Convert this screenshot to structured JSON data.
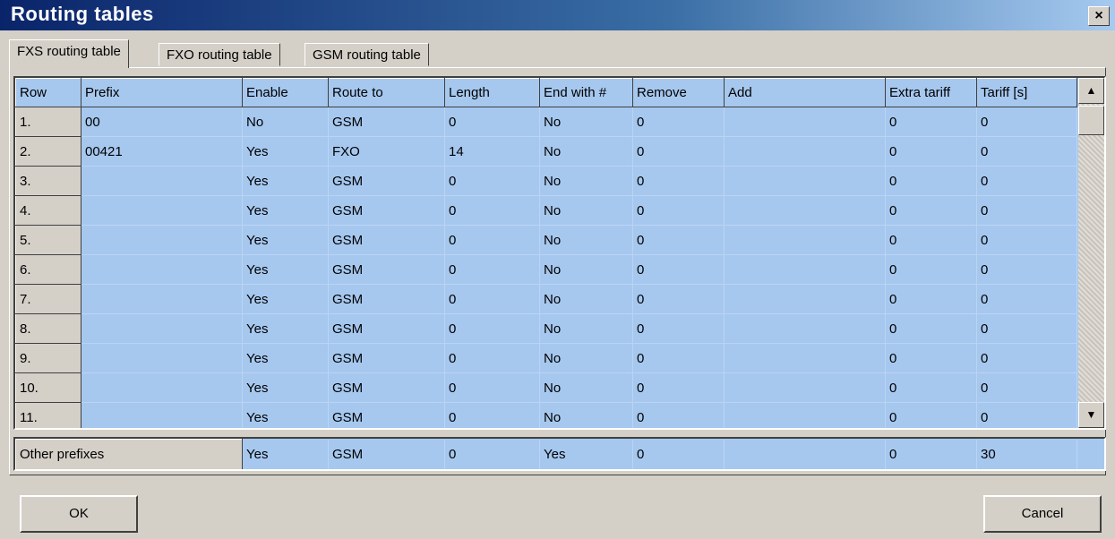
{
  "window": {
    "title": "Routing tables",
    "close_label": "×"
  },
  "tabs": [
    {
      "label": "FXS routing table",
      "active": true
    },
    {
      "label": "FXO routing table",
      "active": false
    },
    {
      "label": "GSM routing table",
      "active": false
    }
  ],
  "columns": [
    "Row",
    "Prefix",
    "Enable",
    "Route to",
    "Length",
    "End with #",
    "Remove",
    "Add",
    "Extra tariff",
    "Tariff [s]"
  ],
  "rows": [
    [
      "1.",
      "00",
      "No",
      "GSM",
      "0",
      "No",
      "0",
      "",
      "0",
      "0"
    ],
    [
      "2.",
      "00421",
      "Yes",
      "FXO",
      "14",
      "No",
      "0",
      "",
      "0",
      "0"
    ],
    [
      "3.",
      "",
      "Yes",
      "GSM",
      "0",
      "No",
      "0",
      "",
      "0",
      "0"
    ],
    [
      "4.",
      "",
      "Yes",
      "GSM",
      "0",
      "No",
      "0",
      "",
      "0",
      "0"
    ],
    [
      "5.",
      "",
      "Yes",
      "GSM",
      "0",
      "No",
      "0",
      "",
      "0",
      "0"
    ],
    [
      "6.",
      "",
      "Yes",
      "GSM",
      "0",
      "No",
      "0",
      "",
      "0",
      "0"
    ],
    [
      "7.",
      "",
      "Yes",
      "GSM",
      "0",
      "No",
      "0",
      "",
      "0",
      "0"
    ],
    [
      "8.",
      "",
      "Yes",
      "GSM",
      "0",
      "No",
      "0",
      "",
      "0",
      "0"
    ],
    [
      "9.",
      "",
      "Yes",
      "GSM",
      "0",
      "No",
      "0",
      "",
      "0",
      "0"
    ],
    [
      "10.",
      "",
      "Yes",
      "GSM",
      "0",
      "No",
      "0",
      "",
      "0",
      "0"
    ],
    [
      "11.",
      "",
      "Yes",
      "GSM",
      "0",
      "No",
      "0",
      "",
      "0",
      "0"
    ]
  ],
  "other_prefixes": {
    "label": "Other prefixes",
    "values": [
      "Yes",
      "GSM",
      "0",
      "Yes",
      "0",
      "",
      "0",
      "30"
    ]
  },
  "scrollbar": {
    "up_icon": "▲",
    "down_icon": "▼"
  },
  "buttons": {
    "ok": "OK",
    "cancel": "Cancel"
  },
  "colors": {
    "grid_bg": "#a6c8ef",
    "title_gradient_start": "#0a246a",
    "face": "#d4d0c8"
  }
}
